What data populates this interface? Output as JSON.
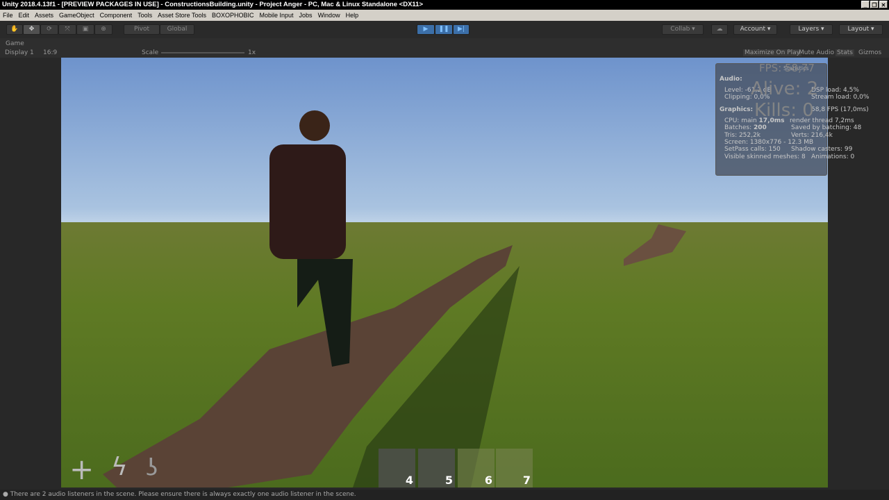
{
  "window": {
    "title": "Unity 2018.4.13f1 - [PREVIEW PACKAGES IN USE] - ConstructionsBuilding.unity - Project Anger - PC, Mac & Linux Standalone <DX11>",
    "controls": [
      "_",
      "❐",
      "✕"
    ]
  },
  "menu": [
    "File",
    "Edit",
    "Assets",
    "GameObject",
    "Component",
    "Tools",
    "Asset Store Tools",
    "BOXOPHOBIC",
    "Mobile Input",
    "Jobs",
    "Window",
    "Help"
  ],
  "toolbar": {
    "tools": [
      "hand-icon",
      "move-icon",
      "rotate-icon",
      "scale-icon",
      "rect-icon",
      "transform-icon"
    ],
    "pivot": "Pivot",
    "global": "Global",
    "collab": "Collab ▾",
    "account": "Account ▾",
    "layers": "Layers ▾",
    "layout": "Layout ▾",
    "play_active": true
  },
  "game": {
    "tab": "Game",
    "display": "Display 1",
    "aspect": "16:9",
    "scale_label": "Scale",
    "scale_value": "1x",
    "maximize": "Maximize On Play",
    "mute": "Mute Audio",
    "stats": "Stats",
    "gizmos": "Gizmos"
  },
  "hud": {
    "fps": "FPS: 58,77",
    "alive": "Alive: 2",
    "kills": "Kills: 0",
    "slots": [
      "4",
      "5",
      "6",
      "7"
    ],
    "icons": [
      "plus-icon",
      "lightning-icon",
      "hook-icon"
    ]
  },
  "statistics": {
    "title": "Statistics",
    "audio": "Audio:",
    "level": "Level: -61,2 dB",
    "clipping": "Clipping: 0,0%",
    "dsp": "DSP load: 4,5%",
    "stream": "Stream load: 0,0%",
    "graphics": "Graphics:",
    "fps": "58,8 FPS (17,0ms)",
    "cpu_prefix": "CPU: main ",
    "cpu_main": "17,0ms",
    "render": "render thread 7,2ms",
    "batches_prefix": "Batches: ",
    "batches": "200",
    "saved": "Saved by batching: 48",
    "tris": "Tris: 252,2k",
    "verts": "Verts: 216,4k",
    "screen": "Screen: 1380x776 - 12.3 MB",
    "setpass": "SetPass calls: 150",
    "shadow": "Shadow casters: 99",
    "skinned": "Visible skinned meshes: 8",
    "anim": "Animations: 0"
  },
  "status": "There are 2 audio listeners in the scene. Please ensure there is always exactly one audio listener in the scene."
}
